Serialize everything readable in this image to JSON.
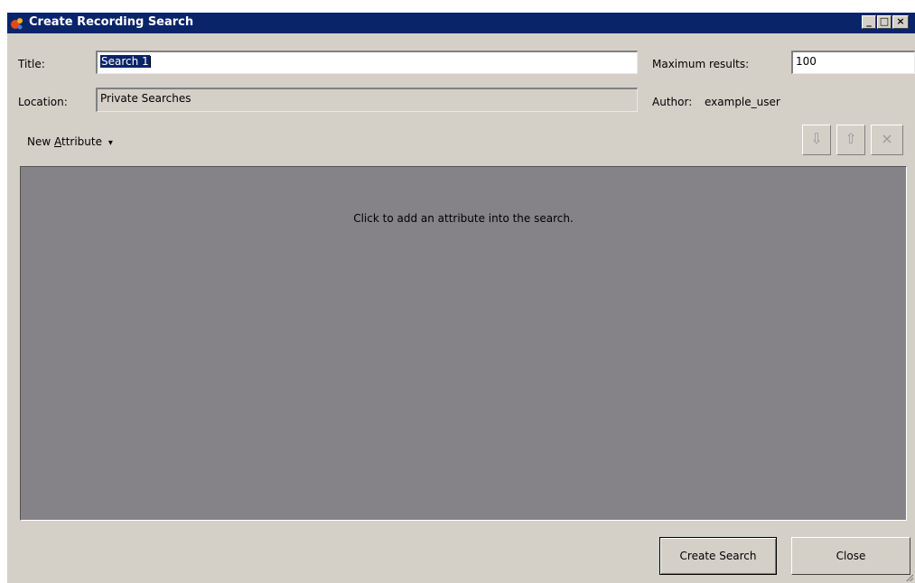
{
  "window": {
    "title": "Create Recording Search",
    "controls": {
      "minimize": "_",
      "maximize": "□",
      "close": "×"
    }
  },
  "form": {
    "title_label": "Title:",
    "title_value": "Search 1",
    "location_label": "Location:",
    "location_value": "Private Searches",
    "max_results_label": "Maximum results:",
    "max_results_value": "100",
    "author_label": "Author:",
    "author_value": "example_user"
  },
  "toolbar": {
    "new_attribute_prefix": "New ",
    "new_attribute_accel": "A",
    "new_attribute_rest": "ttribute",
    "dropdown_arrow": "▾",
    "move_down_icon": "⇩",
    "move_up_icon": "⇧",
    "remove_icon": "×"
  },
  "attributes": {
    "hint": "Click to add an attribute into the search."
  },
  "buttons": {
    "create_search": "Create Search",
    "close": "Close"
  },
  "colors": {
    "titlebar": "#0a246a",
    "window_bg": "#d4d0c8",
    "attr_area_bg": "#858387"
  }
}
